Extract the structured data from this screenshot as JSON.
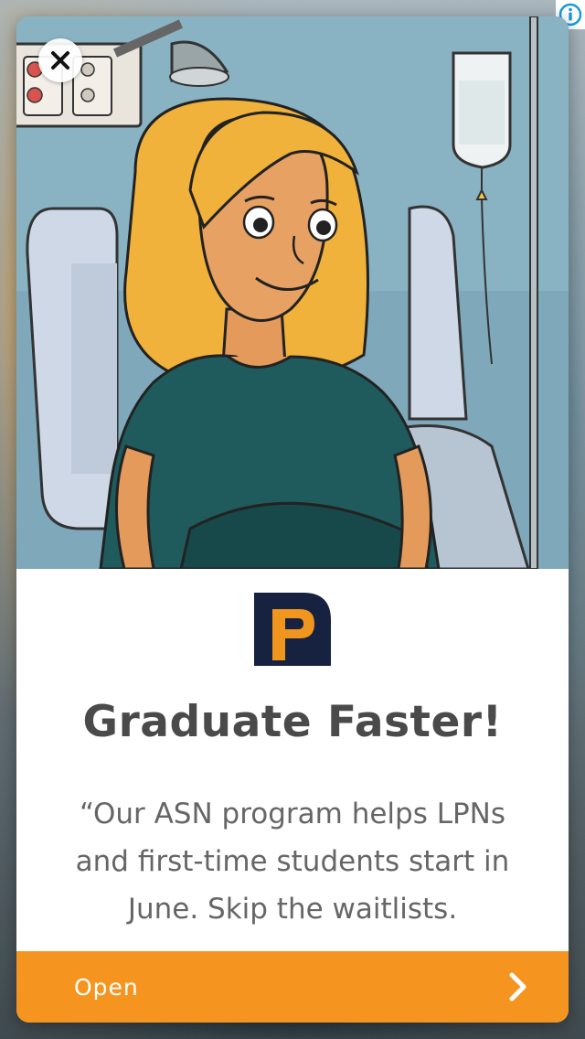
{
  "ad": {
    "headline": "Graduate Faster!",
    "description": "“Our ASN program helps LPNs and first-time students start in June. Skip the waitlists.",
    "cta_label": "Open",
    "brand_logo_letter": "P",
    "close_icon": "close-icon",
    "info_icon": "info-icon",
    "chevron_icon": "chevron-right-icon"
  },
  "colors": {
    "cta_background": "#f5951f",
    "logo_navy": "#16223f",
    "logo_orange": "#f0951e",
    "headline": "#4a4a4a",
    "description": "#666666"
  }
}
